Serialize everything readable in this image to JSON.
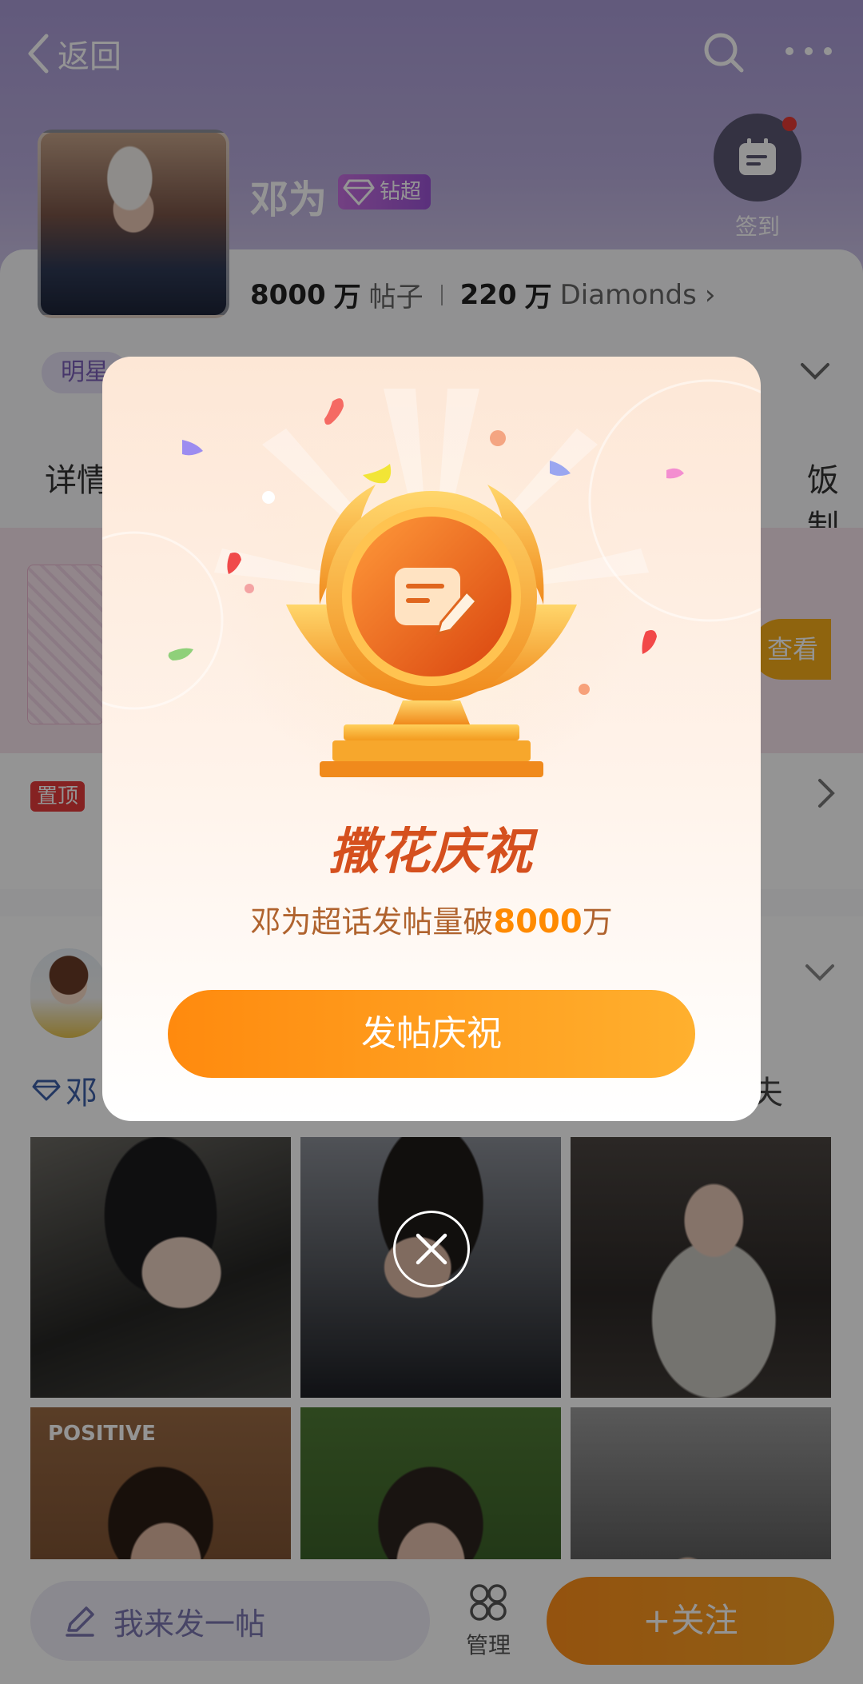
{
  "topbar": {
    "back_label": "返回"
  },
  "profile": {
    "name": "邓为",
    "badge": "钻超",
    "checkin_label": "签到",
    "stats": {
      "posts_value": "8000",
      "posts_unit": "万",
      "posts_label": "帖子",
      "diamonds_value": "220",
      "diamonds_unit": "万",
      "diamonds_label": "Diamonds"
    }
  },
  "tags": {
    "star_label": "明星"
  },
  "tabs": {
    "first": "详情",
    "last": "饭制"
  },
  "banner": {
    "button_label": "查看"
  },
  "pinned": {
    "badge": "置顶"
  },
  "post": {
    "title_start": "邓",
    "title_end": "夫"
  },
  "grid": {
    "cell4_text": "POSITIVE"
  },
  "bottom": {
    "compose_placeholder": "我来发一帖",
    "manage_label": "管理",
    "follow_label": "+关注"
  },
  "modal": {
    "title": "撒花庆祝",
    "subtitle_prefix": "邓为超话发帖量破",
    "subtitle_number": "8000",
    "subtitle_suffix": "万",
    "button_label": "发帖庆祝"
  },
  "colors": {
    "accent_orange": "#ff8a00",
    "modal_title": "#d5501e",
    "header_purple": "#a99bd6"
  }
}
